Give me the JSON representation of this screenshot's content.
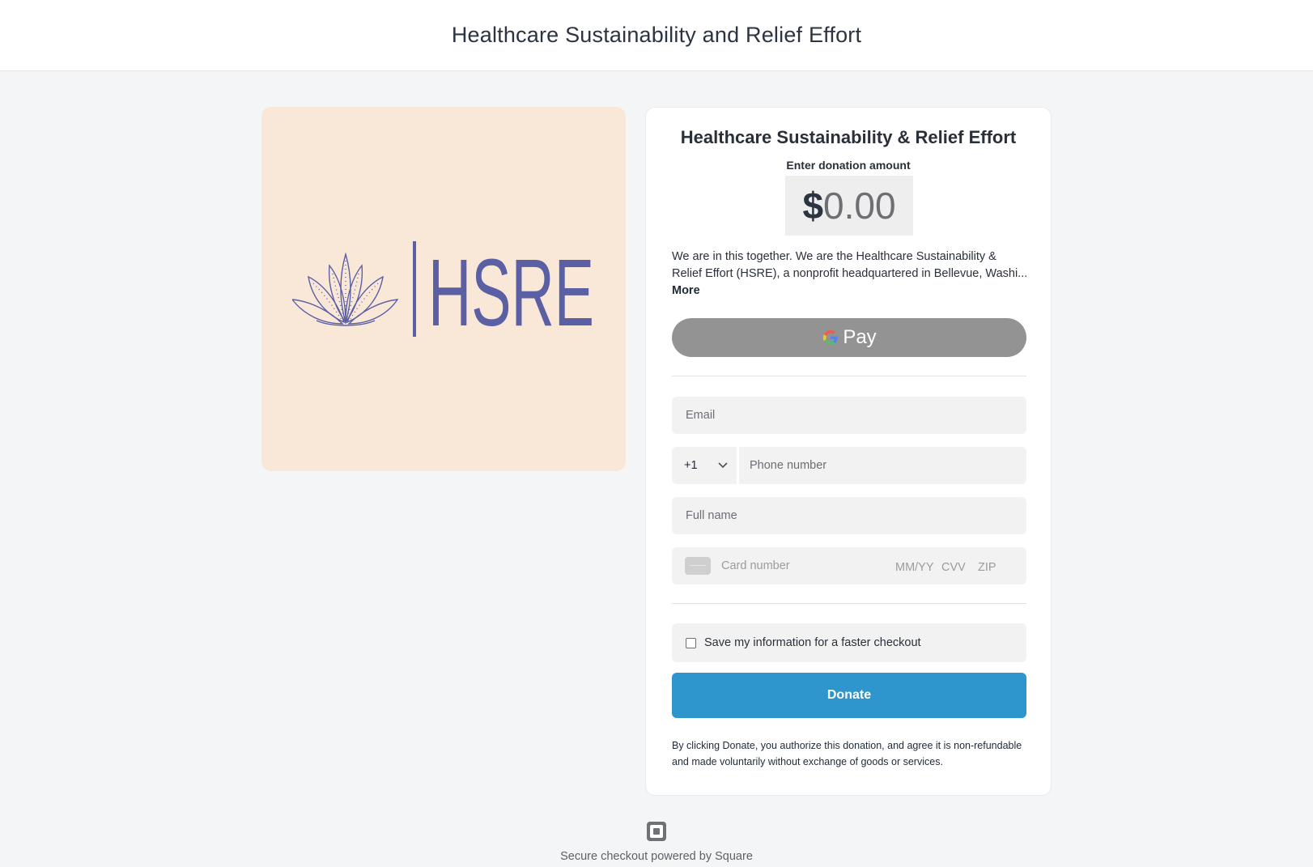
{
  "header": {
    "title": "Healthcare Sustainability and Relief Effort"
  },
  "logo": {
    "text": "HSRE",
    "icon": "lotus-icon"
  },
  "form": {
    "org_title": "Healthcare Sustainability & Relief Effort",
    "amount_label": "Enter donation amount",
    "currency_symbol": "$",
    "amount_value": "0.00",
    "description_line1": "We are in this together. We are the Healthcare Sustainability &",
    "description_line2": "Relief Effort (HSRE), a nonprofit headquartered in Bellevue, Washi...",
    "more_label": "More",
    "gpay_label": "Pay",
    "email_placeholder": "Email",
    "country_code": "+1",
    "phone_placeholder": "Phone number",
    "fullname_placeholder": "Full name",
    "card_placeholder": "Card number",
    "expiry_placeholder": "MM/YY",
    "cvv_placeholder": "CVV",
    "zip_placeholder": "ZIP",
    "save_label": "Save my information for a faster checkout",
    "save_checked": false,
    "donate_label": "Donate",
    "legal_text": "By clicking Donate, you authorize this donation, and agree it is non-refundable and made voluntarily without exchange of goods or services."
  },
  "footer": {
    "text": "Secure checkout powered by Square",
    "icon": "square-logo-icon"
  },
  "colors": {
    "accent": "#2e96cc",
    "logo_background": "#f9e8d8",
    "logo_ink": "#5b5fa3",
    "gpay_button": "#939393"
  }
}
